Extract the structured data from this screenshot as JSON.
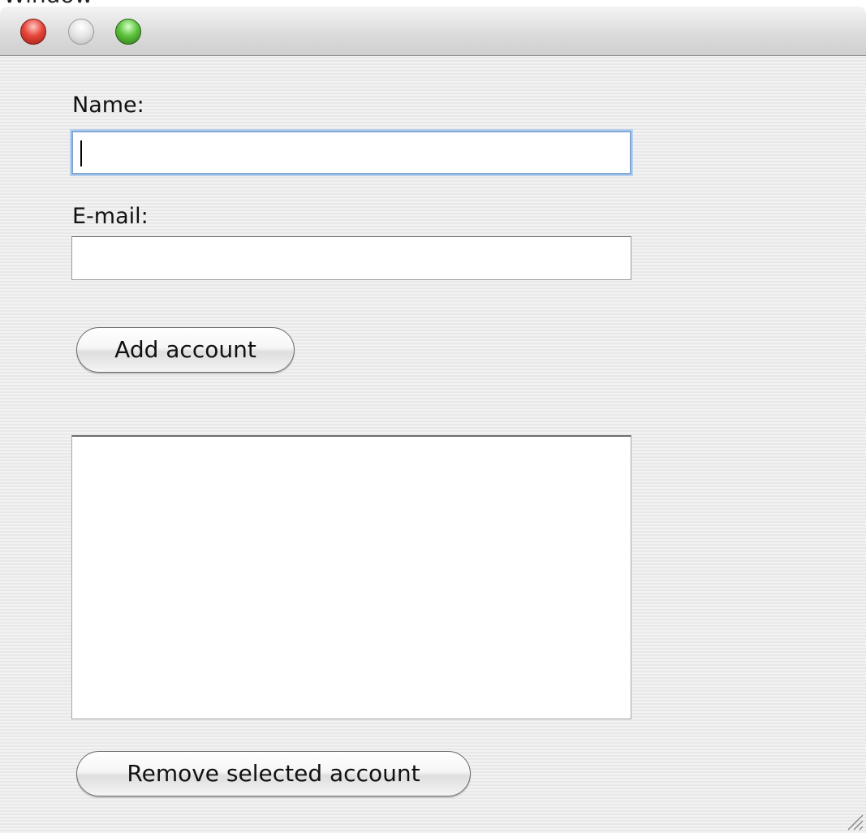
{
  "clipped_title": "Window",
  "window": {
    "traffic_lights": {
      "close": {
        "icon": "close-icon",
        "color": "#e6463a"
      },
      "minimize": {
        "icon": "minimize-icon",
        "color": "#d9d9d9"
      },
      "zoom": {
        "icon": "zoom-icon",
        "color": "#5cc23c"
      }
    }
  },
  "form": {
    "name_label": "Name:",
    "name_value": "",
    "email_label": "E-mail:",
    "email_value": "",
    "add_button_label": "Add account",
    "remove_button_label": "Remove selected account",
    "accounts": []
  },
  "colors": {
    "focus_ring": "#7fa8d8",
    "window_background": "#ececec"
  }
}
